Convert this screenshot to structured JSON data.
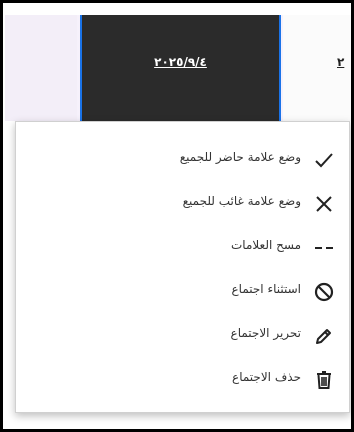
{
  "header": {
    "selected_date": "٢٠٢٥/٩/٤",
    "next_date_partial": "٢"
  },
  "menu": {
    "items": [
      {
        "label": "وضع علامة حاضر للجميع",
        "icon": "check-icon"
      },
      {
        "label": "وضع علامة غائب للجميع",
        "icon": "close-icon"
      },
      {
        "label": "مسح العلامات",
        "icon": "dash-icon"
      },
      {
        "label": "استثناء اجتماع",
        "icon": "block-icon"
      },
      {
        "label": "تحرير الاجتماع",
        "icon": "pencil-icon"
      },
      {
        "label": "حذف الاجتماع",
        "icon": "trash-icon"
      }
    ]
  },
  "colors": {
    "selected_column_bg": "#2b2b2b",
    "selected_column_border": "#1a73e8",
    "menu_bg": "#ffffff",
    "text": "#333333"
  }
}
